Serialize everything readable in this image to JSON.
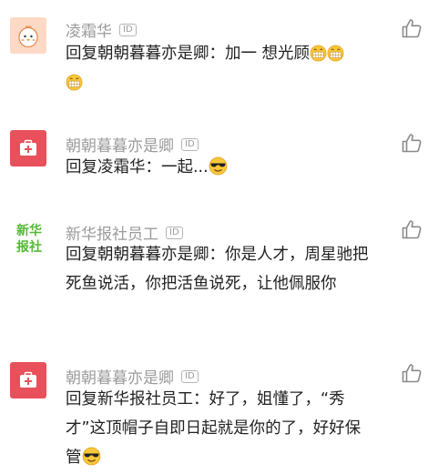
{
  "comments": [
    {
      "author": "凌霜华",
      "badge": "ID",
      "text": "回复朝朝暮暮亦是卿：加一 想光顾",
      "emojis": [
        "grin-emoji",
        "grin-emoji",
        "grin-emoji"
      ]
    },
    {
      "author": "朝朝暮暮亦是卿",
      "badge": "ID",
      "text": "回复凌霜华：一起...",
      "emojis": [
        "sunglasses-emoji"
      ]
    },
    {
      "author": "新华报社员工",
      "badge": "ID",
      "avatar_text": [
        "新华",
        "报社"
      ],
      "text": "回复朝朝暮暮亦是卿：你是人才，周星驰把死鱼说活，你把活鱼说死，让他佩服你"
    },
    {
      "author": "朝朝暮暮亦是卿",
      "badge": "ID",
      "text": "回复新华报社员工：好了，姐懂了，“秀才”这顶帽子自即日起就是你的了，好好保管",
      "emojis": [
        "sunglasses-emoji"
      ]
    }
  ],
  "colors": {
    "name_gray": "#9b9b9b",
    "text": "#222222",
    "avatar_red": "#e8505b",
    "xinhua_green": "#55b837",
    "like_icon": "#8a8a8a"
  }
}
